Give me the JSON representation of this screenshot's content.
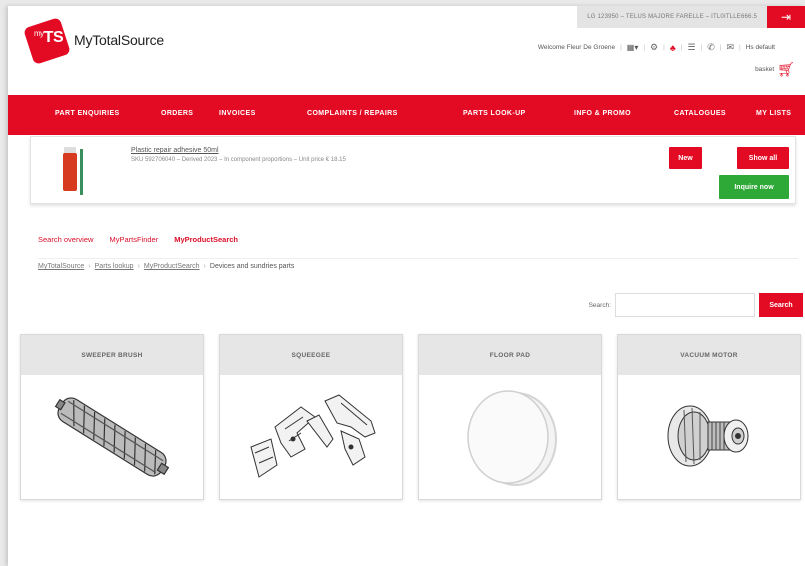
{
  "header": {
    "top_info": "LG 123950 – TELUS MAJORE FARELLE – ITL0ITLLE666.5",
    "logo_prefix": "my",
    "logo_mark": "TS",
    "logo_name": "MyTotalSource",
    "welcome": "Welcome Fleur De Groene",
    "utility_label": "Hs default",
    "basket_label": "basket"
  },
  "nav": {
    "items": [
      "PART ENQUIRIES",
      "ORDERS",
      "INVOICES",
      "COMPLAINTS / REPAIRS",
      "PARTS LOOK-UP",
      "INFO & PROMO",
      "CATALOGUES",
      "MY LISTS"
    ]
  },
  "notice": {
    "title": "Plastic repair adhesive 50ml",
    "desc": "SKU 592706040 – Derived 2023 – In component proportions – Unit price € 18.15",
    "button_new": "New",
    "button_show_all": "Show all",
    "button_inquire": "Inquire now"
  },
  "tabs": [
    "Search overview",
    "MyPartsFinder",
    "MyProductSearch"
  ],
  "breadcrumb": [
    "MyTotalSource",
    "Parts lookup",
    "MyProductSearch",
    "Devices and sundries parts"
  ],
  "search": {
    "label": "Search:",
    "value": "",
    "button": "Search"
  },
  "categories": [
    "SWEEPER BRUSH",
    "SQUEEGEE",
    "FLOOR PAD",
    "VACUUM MOTOR"
  ]
}
